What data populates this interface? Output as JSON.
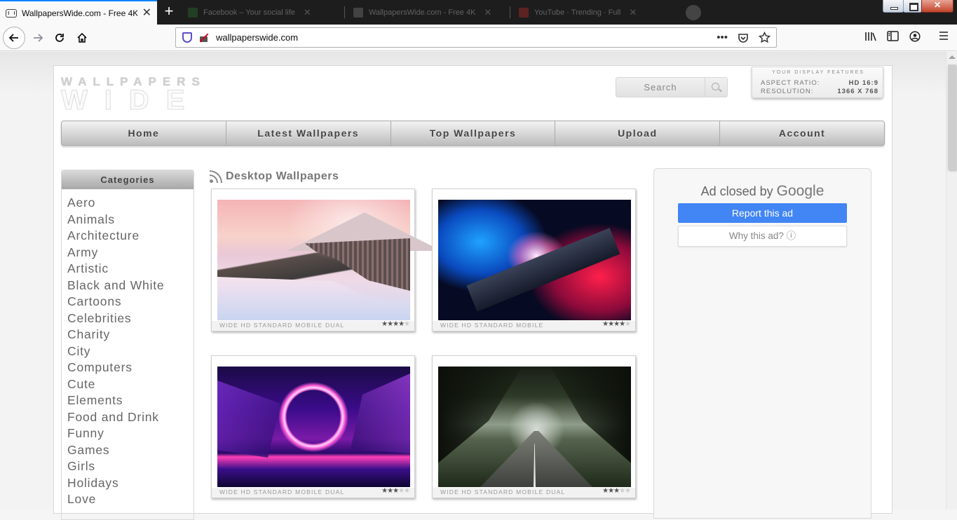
{
  "browser": {
    "active_tab": {
      "title": "WallpapersWide.com - Free 4K",
      "close": "✕"
    },
    "background_tabs": [
      {
        "title": "Facebook – Your social life",
        "color": "#2e7d32"
      },
      {
        "title": "WallpapersWide.com - Free 4K",
        "color": "#888888"
      },
      {
        "title": "YouTube · Trending · Full",
        "color": "#d32f2f"
      }
    ],
    "new_tab": "+",
    "url": "wallpaperswide.com",
    "page_actions": "•••"
  },
  "site": {
    "logo_top": "WALLPAPERS",
    "logo_bottom": "WIDE",
    "search_placeholder": "Search",
    "display": {
      "header": "YOUR DISPLAY FEATURES",
      "aspect_label": "ASPECT RATIO:",
      "aspect_value": "HD 16:9",
      "res_label": "RESOLUTION:",
      "res_value": "1366 X 768"
    },
    "menu": [
      "Home",
      "Latest Wallpapers",
      "Top Wallpapers",
      "Upload",
      "Account"
    ],
    "categories_title": "Categories",
    "categories": [
      "Aero",
      "Animals",
      "Architecture",
      "Army",
      "Artistic",
      "Black and White",
      "Cartoons",
      "Celebrities",
      "Charity",
      "City",
      "Computers",
      "Cute",
      "Elements",
      "Food and Drink",
      "Funny",
      "Games",
      "Girls",
      "Holidays",
      "Love"
    ],
    "section_title": "Desktop Wallpapers",
    "wallpapers": [
      {
        "formats": "WIDE  HD  STANDARD  MOBILE  DUAL",
        "rating": 3.5
      },
      {
        "formats": "WIDE  HD  STANDARD  MOBILE",
        "rating": 4
      },
      {
        "formats": "WIDE  HD  STANDARD  MOBILE  DUAL",
        "rating": 3
      },
      {
        "formats": "WIDE  HD  STANDARD  MOBILE  DUAL",
        "rating": 3
      }
    ],
    "ad": {
      "closed_by": "Ad closed by",
      "google": "Google",
      "report": "Report this ad",
      "why": "Why this ad? ⓘ"
    }
  },
  "colors": {
    "accent_tab": "#0a84ff",
    "report_button": "#4285f4"
  }
}
